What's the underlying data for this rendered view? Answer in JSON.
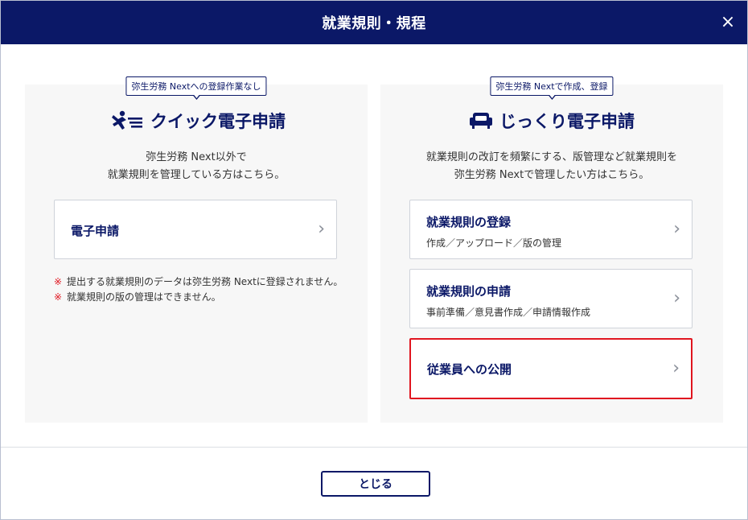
{
  "dialog": {
    "title": "就業規則・規程",
    "close_icon": "×"
  },
  "left_panel": {
    "tag": "弥生労務 Nextへの登録作業なし",
    "heading": "クイック電子申請",
    "heading_icon": "running-person-icon",
    "desc_line1": "弥生労務 Next以外で",
    "desc_line2": "就業規則を管理している方はこちら。",
    "card": {
      "label": "電子申請"
    },
    "notes": [
      {
        "mark": "※",
        "text": "提出する就業規則のデータは弥生労務 Nextに登録されません。"
      },
      {
        "mark": "※",
        "text": "就業規則の版の管理はできません。"
      }
    ]
  },
  "right_panel": {
    "tag": "弥生労務 Nextで作成、登録",
    "heading": "じっくり電子申請",
    "heading_icon": "sofa-icon",
    "desc_line1": "就業規則の改訂を頻繁にする、版管理など就業規則を",
    "desc_line2": "弥生労務 Nextで管理したい方はこちら。",
    "cards": [
      {
        "label": "就業規則の登録",
        "sub": "作成／アップロード／版の管理"
      },
      {
        "label": "就業規則の申請",
        "sub": "事前準備／意見書作成／申請情報作成"
      },
      {
        "label": "従業員への公開",
        "sub": ""
      }
    ]
  },
  "chevron": "›",
  "footer": {
    "close_button": "とじる"
  },
  "colors": {
    "navy": "#0b1867",
    "highlight": "#e0151f",
    "panel": "#f7f7f7"
  }
}
